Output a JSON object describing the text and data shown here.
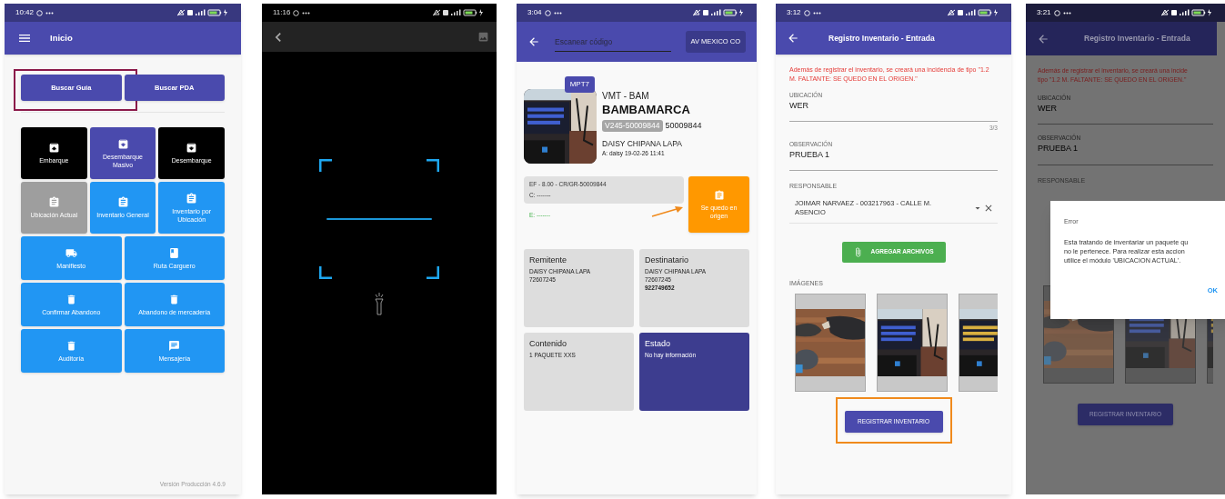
{
  "home": {
    "time": "10:42",
    "title": "Inicio",
    "search_buttons": [
      {
        "label": "Buscar Guía",
        "highlighted": true
      },
      {
        "label": "Buscar PDA",
        "highlighted": false
      }
    ],
    "tile_rows": [
      [
        {
          "label": "Embarque",
          "kind": "unarchive",
          "color": "#000000"
        },
        {
          "label": "Desembarque Masivo",
          "kind": "archive",
          "color": "#4a4aad"
        },
        {
          "label": "Desembarque",
          "kind": "archive",
          "color": "#000000"
        }
      ],
      [
        {
          "label": "Ubicación Actual",
          "kind": "clipboard",
          "color": "#9e9e9e"
        },
        {
          "label": "Inventario General",
          "kind": "clipboard",
          "color": "#2196f3"
        },
        {
          "label": "Inventario por Ubicación",
          "kind": "clipboard",
          "color": "#2196f3"
        }
      ],
      [
        {
          "label": "Manifiesto",
          "kind": "truck",
          "color": "#2196f3"
        },
        {
          "label": "Ruta Carguero",
          "kind": "book",
          "color": "#2196f3"
        }
      ],
      [
        {
          "label": "Confirmar Abandono",
          "kind": "trash",
          "color": "#2196f3"
        },
        {
          "label": "Abandono de mercadería",
          "kind": "trash",
          "color": "#2196f3"
        }
      ],
      [
        {
          "label": "Auditoría",
          "kind": "trash",
          "color": "#2196f3"
        },
        {
          "label": "Mensajería",
          "kind": "chat",
          "color": "#2196f3"
        }
      ]
    ],
    "version": "Versión Producción 4.6.9"
  },
  "scanner": {
    "time": "11:16"
  },
  "detail": {
    "time": "3:04",
    "search": {
      "placeholder": "Escanear código"
    },
    "agency_button": "AV MEXICO CO",
    "badge": "MPT7",
    "photo": {
      "kind": "picture"
    },
    "route": "VMT - BAM",
    "city": "BAMBAMARCA",
    "guide_tag": "V245-50009844",
    "guide_number": "50009844",
    "customer": "DAISY CHIPANA LAPA",
    "audit": "A: daisy 19-02-26 11:41",
    "charges": [
      "EF - 8.00 - CR/GR-50009844",
      "C: -------"
    ],
    "extra": "E: -------",
    "action": {
      "label": "Se quedo en origen",
      "highlighted": true
    },
    "cards": [
      {
        "title": "Remitente",
        "color": "#dddddd",
        "lines": [
          {
            "text": "DAISY CHIPANA LAPA",
            "bold": false
          },
          {
            "text": "72607245",
            "bold": false
          }
        ]
      },
      {
        "title": "Destinatario",
        "color": "#dddddd",
        "lines": [
          {
            "text": "DAISY CHIPANA LAPA",
            "bold": false
          },
          {
            "text": "72607245",
            "bold": false
          },
          {
            "text": "922749652",
            "bold": true
          }
        ]
      },
      {
        "title": "Contenido",
        "color": "#dddddd",
        "lines": [
          {
            "text": "1 PAQUETE XXS",
            "bold": false
          }
        ]
      },
      {
        "title": "Estado",
        "color": "#3d3d8f",
        "lines": [
          {
            "text": "No hay información",
            "bold": false
          }
        ]
      }
    ]
  },
  "form": {
    "time": "3:12",
    "title": "Registro Inventario - Entrada",
    "warning": "Además de registrar el inventario, se creará una incidencia de tipo \"1.2 M. FALTANTE: SE QUEDO EN EL ORIGEN.\"",
    "fields": [
      {
        "label": "UBICACIÓN",
        "value": "WER",
        "counter": "3/3"
      },
      {
        "label": "OBSERVACIÓN",
        "value": "PRUEBA 1"
      }
    ],
    "responsable": {
      "label": "RESPONSABLE",
      "value": "JOIMAR NARVAEZ - 003217963 - CALLE M. ASENCIO"
    },
    "attach_button": "AGREGAR ARCHIVOS",
    "images_label": "IMÁGENES",
    "images": [
      {
        "kind": "picture"
      },
      {
        "kind": "picture"
      },
      {
        "kind": "picture"
      }
    ],
    "submit": {
      "label": "REGISTRAR INVENTARIO",
      "highlighted": true
    }
  },
  "error": {
    "time": "3:21",
    "title": "Registro Inventario - Entrada",
    "warning_lines": [
      "Además de registrar el inventario, se creará una incide",
      "tipo \"1.2 M. FALTANTE: SE QUEDO EN EL ORIGEN.\""
    ],
    "fields": [
      {
        "label": "UBICACIÓN",
        "value": "WER"
      },
      {
        "label": "OBSERVACIÓN",
        "value": "PRUEBA 1"
      }
    ],
    "responsable_label": "RESPONSABLE",
    "images": [
      {
        "kind": "picture"
      },
      {
        "kind": "picture"
      },
      {
        "kind": "picture"
      }
    ],
    "submit": "REGISTRAR INVENTARIO",
    "dialog": {
      "title": "Error",
      "lines": [
        "Esta tratando de inventariar un paquete qu",
        "no le pertenece. Para realizar esta accion",
        "utilice el módulo 'UBICACION ACTUAL'."
      ],
      "button": "OK"
    }
  }
}
